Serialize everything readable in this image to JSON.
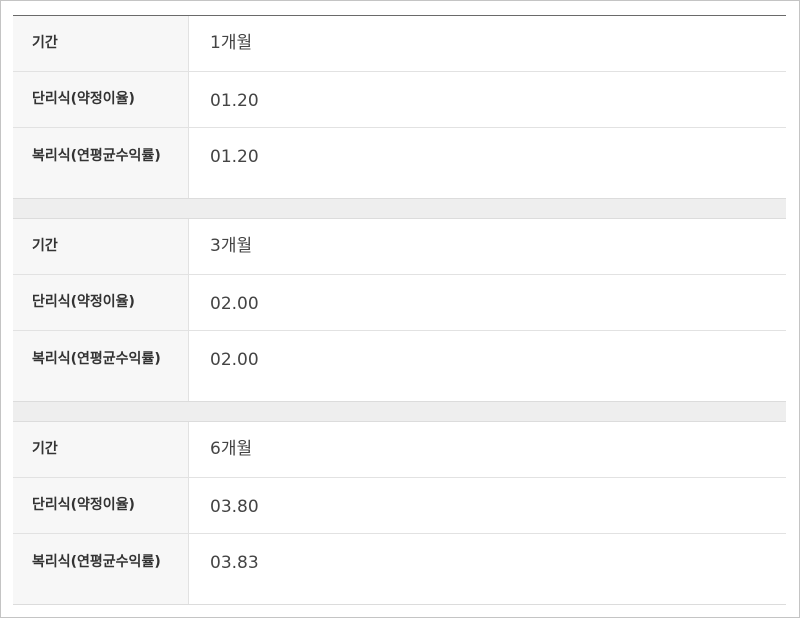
{
  "rate_table": {
    "groups": [
      {
        "period_label": "기간",
        "period_value": "1개월",
        "simple_label": "단리식(약정이율)",
        "simple_value": "01.20",
        "compound_label": "복리식(연평균수익률)",
        "compound_value": "01.20"
      },
      {
        "period_label": "기간",
        "period_value": "3개월",
        "simple_label": "단리식(약정이율)",
        "simple_value": "02.00",
        "compound_label": "복리식(연평균수익률)",
        "compound_value": "02.00"
      },
      {
        "period_label": "기간",
        "period_value": "6개월",
        "simple_label": "단리식(약정이율)",
        "simple_value": "03.80",
        "compound_label": "복리식(연평균수익률)",
        "compound_value": "03.83"
      }
    ]
  }
}
